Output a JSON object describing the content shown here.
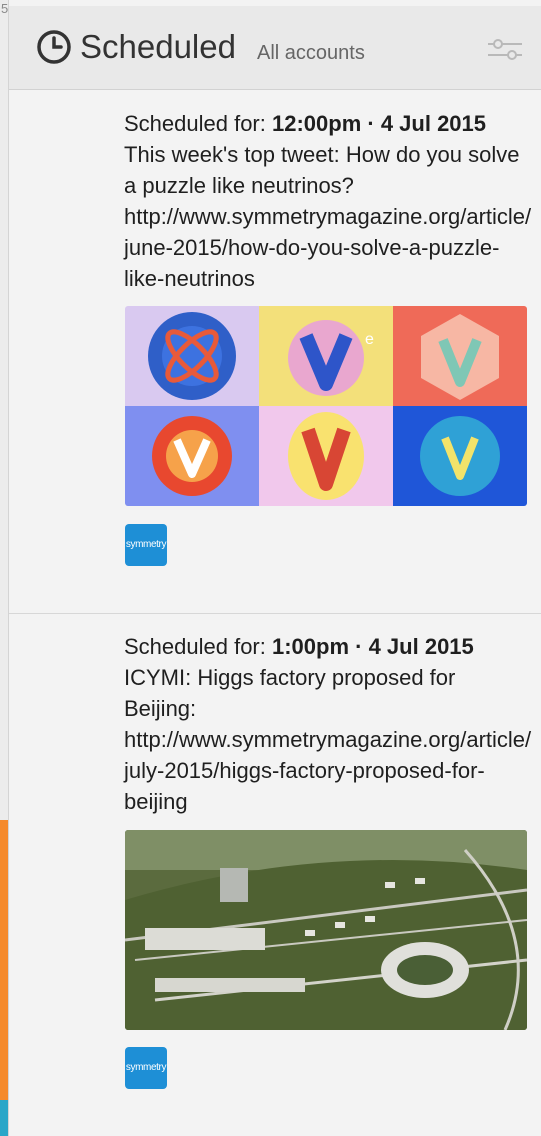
{
  "column": {
    "index": "5",
    "title": "Scheduled",
    "subtitle": "All accounts",
    "icon": "clock-icon",
    "filter_icon": "sliders-icon"
  },
  "tweets": [
    {
      "scheduled_label": "Scheduled for:",
      "time": "12:00pm · 4 Jul 2015",
      "text": "This week's top tweet: How do you solve a puzzle like neutrinos? http://www.symmetrymagazine.org/article/june-2015/how-do-you-solve-a-puzzle-like-neutrinos",
      "media": "neutrino-illustration-grid",
      "avatar_text": "symmetry"
    },
    {
      "scheduled_label": "Scheduled for:",
      "time": "1:00pm · 4 Jul 2015",
      "text": "ICYMI: Higgs factory proposed for Beijing: http://www.symmetrymagazine.org/article/july-2015/higgs-factory-proposed-for-beijing",
      "media": "higgs-factory-aerial-render",
      "avatar_text": "symmetry"
    }
  ],
  "colors": {
    "avatar": "#1e8fd6",
    "accent_orange": "#f58a2c",
    "accent_teal": "#2aa6c8"
  }
}
